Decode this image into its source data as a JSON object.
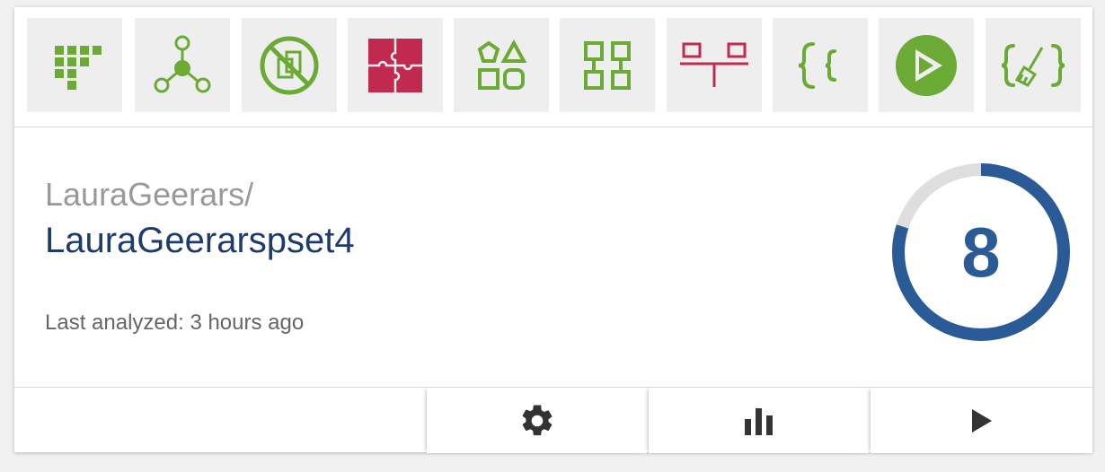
{
  "header_icons": [
    {
      "name": "gradient-grid-icon",
      "color": "#6aaa35"
    },
    {
      "name": "node-graph-icon",
      "color": "#6aaa35"
    },
    {
      "name": "no-copy-icon",
      "color": "#6aaa35"
    },
    {
      "name": "puzzle-icon",
      "color": "#c2294f"
    },
    {
      "name": "shapes-grid-icon",
      "color": "#6aaa35"
    },
    {
      "name": "modules-grid-icon",
      "color": "#6aaa35"
    },
    {
      "name": "balance-icon",
      "color": "#c2294f"
    },
    {
      "name": "braces-icon",
      "color": "#6aaa35"
    },
    {
      "name": "play-circle-icon",
      "color": "#6aaa35"
    },
    {
      "name": "broom-braces-icon",
      "color": "#6aaa35"
    }
  ],
  "repo": {
    "owner": "LauraGeerars/",
    "name": "LauraGeerarspset4",
    "last_analyzed": "Last analyzed: 3 hours ago"
  },
  "score": {
    "value": "8",
    "fraction": 0.8,
    "color": "#2b5b97",
    "track_color": "#dedede"
  },
  "footer": [
    {
      "name": "gear-icon"
    },
    {
      "name": "bar-chart-icon"
    },
    {
      "name": "play-icon"
    }
  ]
}
